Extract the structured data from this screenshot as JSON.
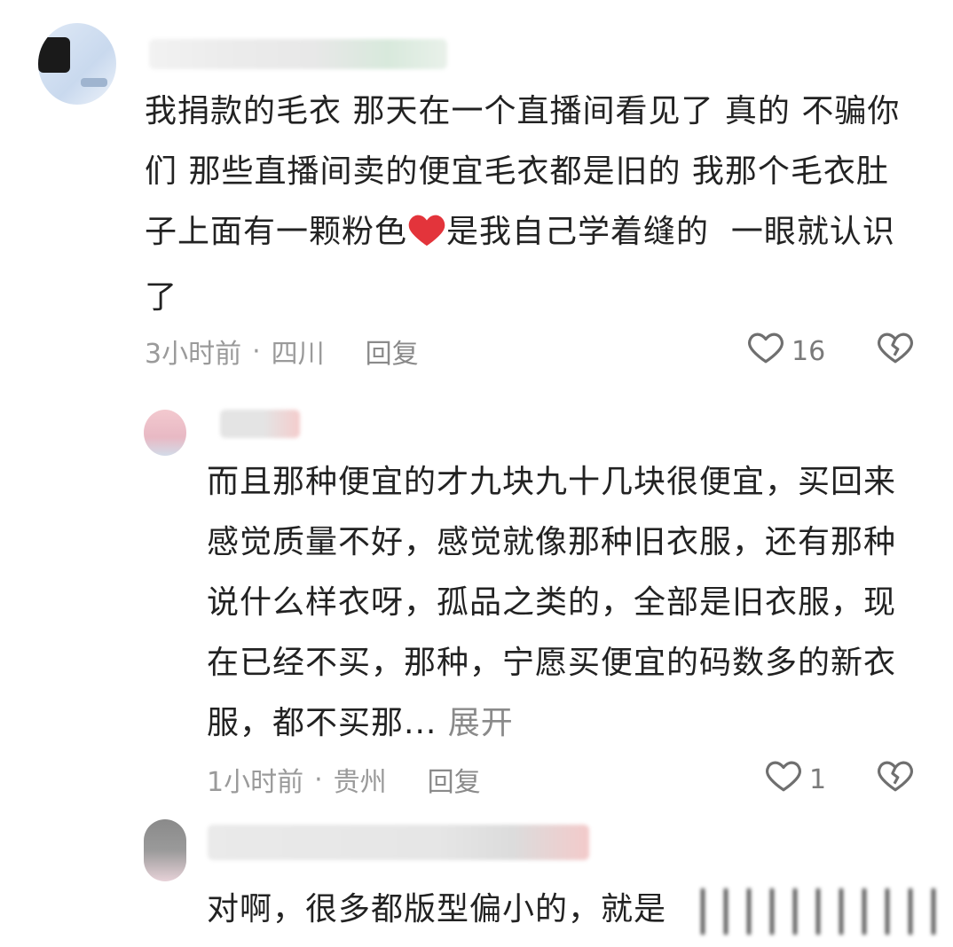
{
  "comments": [
    {
      "text_segments": [
        "我捐款的毛衣 那天在一个直播间看见了 真的 不骗你们 那些直播间卖的便宜毛衣都是旧的 我那个毛衣肚子上面有一颗粉色",
        "是我自己学着缝的  一眼就认识了"
      ],
      "emoji": "red-heart-emoji",
      "time": "3小时前",
      "location": "四川",
      "reply_label": "回复",
      "likes": "16"
    },
    {
      "text": "而且那种便宜的才九块九十几块很便宜，买回来感觉质量不好，感觉就像那种旧衣服，还有那种说什么样衣呀，孤品之类的，全部是旧衣服，现在已经不买，那种，宁愿买便宜的码数多的新衣服，都不买那...",
      "expand_label": "展开",
      "time": "1小时前",
      "location": "贵州",
      "reply_label": "回复",
      "likes": "1"
    },
    {
      "text": "对啊，很多都版型偏小的，就是"
    }
  ],
  "separator": "·",
  "colors": {
    "text": "#222222",
    "meta": "#9a9a9a",
    "icon": "#6f6f6f",
    "emoji_red": "#e3343b"
  }
}
